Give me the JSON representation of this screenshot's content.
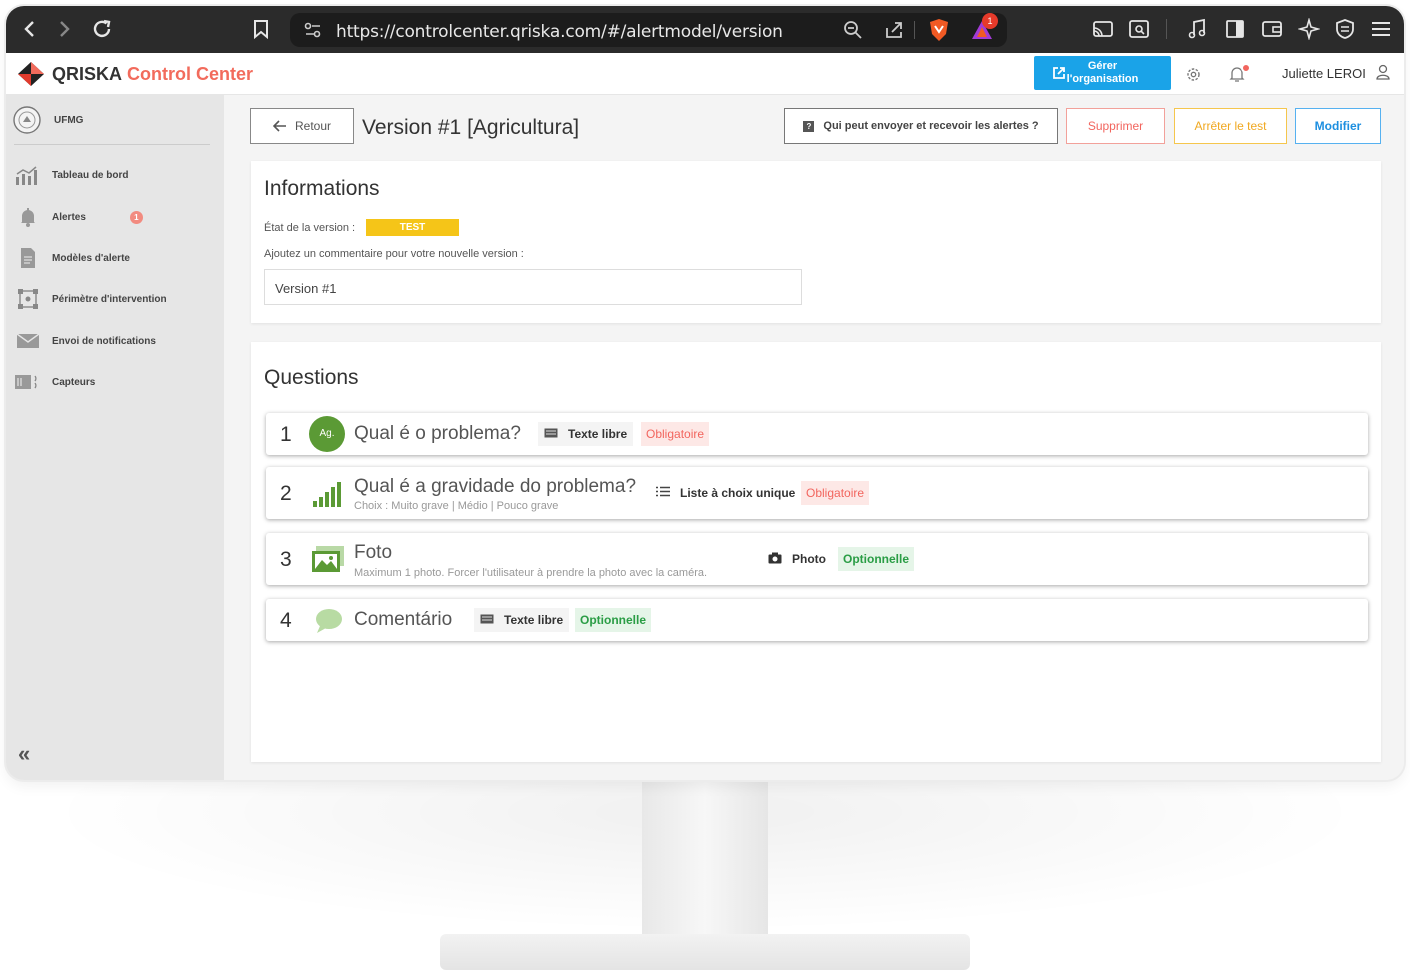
{
  "browser": {
    "url": "https://controlcenter.qriska.com/#/alertmodel/version",
    "shields_badge": "1"
  },
  "header": {
    "brand_name": "QRISKA",
    "brand_suffix": "Control Center",
    "manage_org_label_1": "Gérer",
    "manage_org_label_2": "l'organisation",
    "user_name": "Juliette LEROI"
  },
  "sidebar": {
    "org_name": "UFMG",
    "items": [
      {
        "label": "Tableau de bord",
        "icon": "dashboard-icon"
      },
      {
        "label": "Alertes",
        "icon": "bell-icon",
        "badge": "1"
      },
      {
        "label": "Modèles d'alerte",
        "icon": "document-icon"
      },
      {
        "label": "Périmètre d'intervention",
        "icon": "perimeter-icon"
      },
      {
        "label": "Envoi de notifications",
        "icon": "envelope-icon"
      },
      {
        "label": "Capteurs",
        "icon": "sensor-icon"
      }
    ],
    "collapse_label": "«"
  },
  "toolbar": {
    "back_label": "Retour",
    "page_title": "Version #1 [Agricultura]",
    "who_label": "Qui peut envoyer et recevoir les alertes ?",
    "delete_label": "Supprimer",
    "stop_test_label": "Arrêter le test",
    "edit_label": "Modifier"
  },
  "informations": {
    "title": "Informations",
    "state_label": "État de la version :",
    "state_value": "TEST",
    "comment_label": "Ajoutez un commentaire pour votre nouvelle version :",
    "comment_value": "Version #1"
  },
  "questions": {
    "title": "Questions",
    "items": [
      {
        "num": "1",
        "title": "Qual é o problema?",
        "subtitle": "",
        "avatar": "Ag.",
        "type": "Texte libre",
        "req": "Obligatoire"
      },
      {
        "num": "2",
        "title": "Qual é a gravidade do problema?",
        "subtitle": "Choix : Muito grave | Médio | Pouco grave",
        "type": "Liste à choix unique",
        "req": "Obligatoire"
      },
      {
        "num": "3",
        "title": "Foto",
        "subtitle": "Maximum 1 photo. Forcer l'utilisateur à prendre la photo avec la caméra.",
        "type": "Photo",
        "req": "Optionnelle"
      },
      {
        "num": "4",
        "title": "Comentário",
        "subtitle": "",
        "type": "Texte libre",
        "req": "Optionnelle"
      }
    ]
  },
  "colors": {
    "accent": "#f26b5c",
    "primary": "#1aa3e8",
    "badge_yellow": "#f5c518",
    "green": "#5b9a35"
  }
}
